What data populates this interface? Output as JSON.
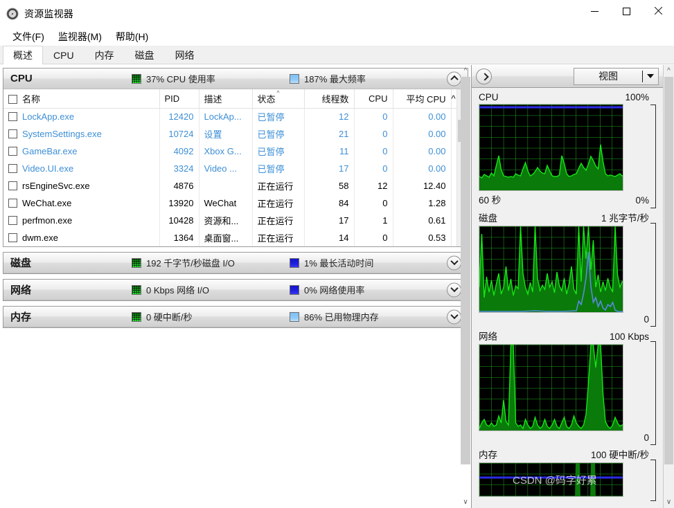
{
  "window": {
    "title": "资源监视器",
    "icon": "resource-monitor-icon",
    "minimize_label": "最小化",
    "maximize_label": "最大化",
    "close_label": "关闭"
  },
  "menu": {
    "items": [
      {
        "label": "文件(F)",
        "text": "文件",
        "accel": "F"
      },
      {
        "label": "监视器(M)",
        "text": "监视器",
        "accel": "M"
      },
      {
        "label": "帮助(H)",
        "text": "帮助",
        "accel": "H"
      }
    ]
  },
  "tabs": {
    "active": "概述",
    "items": [
      {
        "label": "概述",
        "active": true
      },
      {
        "label": "CPU",
        "active": false
      },
      {
        "label": "内存",
        "active": false
      },
      {
        "label": "磁盘",
        "active": false
      },
      {
        "label": "网络",
        "active": false
      }
    ]
  },
  "sections": {
    "cpu": {
      "title": "CPU",
      "expanded": true,
      "stat1": "37% CPU 使用率",
      "stat2": "187% 最大频率",
      "stat1_swatch": "green",
      "stat2_swatch": "light-blue",
      "collapse_label": "折叠"
    },
    "disk": {
      "title": "磁盘",
      "expanded": false,
      "stat1": "192 千字节/秒磁盘 I/O",
      "stat2": "1% 最长活动时间",
      "stat1_swatch": "green",
      "stat2_swatch": "dark-blue",
      "expand_label": "展开"
    },
    "network": {
      "title": "网络",
      "expanded": false,
      "stat1": "0 Kbps 网络 I/O",
      "stat2": "0% 网络使用率",
      "stat1_swatch": "green",
      "stat2_swatch": "dark-blue",
      "expand_label": "展开"
    },
    "memory": {
      "title": "内存",
      "expanded": false,
      "stat1": "0 硬中断/秒",
      "stat2": "86% 已用物理内存",
      "stat1_swatch": "green",
      "stat2_swatch": "light-blue",
      "expand_label": "展开"
    }
  },
  "process_table": {
    "sort_column": "状态",
    "sort_direction": "asc",
    "columns": [
      {
        "key": "name",
        "label": "名称",
        "align": "left"
      },
      {
        "key": "pid",
        "label": "PID",
        "align": "right"
      },
      {
        "key": "desc",
        "label": "描述",
        "align": "left"
      },
      {
        "key": "status",
        "label": "状态",
        "align": "left"
      },
      {
        "key": "threads",
        "label": "线程数",
        "align": "right"
      },
      {
        "key": "cpu",
        "label": "CPU",
        "align": "right"
      },
      {
        "key": "avgcpu",
        "label": "平均 CPU",
        "align": "right"
      }
    ],
    "rows": [
      {
        "name": "LockApp.exe",
        "pid": "12420",
        "desc": "LockAp...",
        "status": "已暂停",
        "threads": "12",
        "cpu": "0",
        "avgcpu": "0.00",
        "state": "suspended"
      },
      {
        "name": "SystemSettings.exe",
        "pid": "10724",
        "desc": "设置",
        "status": "已暂停",
        "threads": "21",
        "cpu": "0",
        "avgcpu": "0.00",
        "state": "suspended"
      },
      {
        "name": "GameBar.exe",
        "pid": "4092",
        "desc": "Xbox G...",
        "status": "已暂停",
        "threads": "11",
        "cpu": "0",
        "avgcpu": "0.00",
        "state": "suspended"
      },
      {
        "name": "Video.UI.exe",
        "pid": "3324",
        "desc": "Video ...",
        "status": "已暂停",
        "threads": "17",
        "cpu": "0",
        "avgcpu": "0.00",
        "state": "suspended"
      },
      {
        "name": "rsEngineSvc.exe",
        "pid": "4876",
        "desc": "",
        "status": "正在运行",
        "threads": "58",
        "cpu": "12",
        "avgcpu": "12.40",
        "state": "running"
      },
      {
        "name": "WeChat.exe",
        "pid": "13920",
        "desc": "WeChat",
        "status": "正在运行",
        "threads": "84",
        "cpu": "0",
        "avgcpu": "1.28",
        "state": "running"
      },
      {
        "name": "perfmon.exe",
        "pid": "10428",
        "desc": "资源和...",
        "status": "正在运行",
        "threads": "17",
        "cpu": "1",
        "avgcpu": "0.61",
        "state": "running"
      },
      {
        "name": "dwm.exe",
        "pid": "1364",
        "desc": "桌面窗...",
        "status": "正在运行",
        "threads": "14",
        "cpu": "0",
        "avgcpu": "0.53",
        "state": "running"
      }
    ]
  },
  "graph_panel": {
    "collapse_button": "collapse-right-arrow",
    "view_button": {
      "label": "视图",
      "caret": "chevron-down-icon"
    },
    "watermark": "CSDN @码字好累",
    "graphs": [
      {
        "name": "cpu-graph",
        "title": "CPU",
        "max_label": "100%",
        "min_label": "0%",
        "time_label": "60 秒",
        "line_color": "#16e616",
        "fill_color": "#0a7a0a",
        "secondary_color": "#2b2be6",
        "has_secondary": true
      },
      {
        "name": "disk-graph",
        "title": "磁盘",
        "max_label": "1 兆字节/秒",
        "min_label": "0",
        "time_label": "",
        "line_color": "#16e616",
        "fill_color": "#0a7a0a",
        "secondary_color": "#5a8ae0",
        "has_secondary": true
      },
      {
        "name": "network-graph",
        "title": "网络",
        "max_label": "100 Kbps",
        "min_label": "0",
        "time_label": "",
        "line_color": "#16e616",
        "fill_color": "#0a7a0a",
        "secondary_color": "",
        "has_secondary": false
      },
      {
        "name": "memory-graph",
        "title": "内存",
        "max_label": "100 硬中断/秒",
        "min_label": "",
        "time_label": "",
        "line_color": "#16e616",
        "fill_color": "#0a7a0a",
        "secondary_color": "#2b2be6",
        "has_secondary": true
      }
    ]
  },
  "chart_data": {
    "type": "area",
    "title": "资源监视器概述图表",
    "graphs": [
      {
        "id": "cpu",
        "title": "CPU",
        "ylabel": "CPU 使用率",
        "ylim": [
          0,
          100
        ],
        "yticks": [
          "0%",
          "100%"
        ],
        "xlabel": "60 秒",
        "series": [
          {
            "name": "CPU 使用率",
            "color": "#16e616",
            "values": [
              18,
              15,
              22,
              19,
              17,
              26,
              20,
              42,
              60,
              34,
              22,
              20,
              18,
              19,
              17,
              24,
              22,
              20,
              34,
              48,
              30,
              22,
              26,
              32,
              40,
              33,
              28,
              26,
              46,
              30,
              22,
              20,
              21,
              23,
              60,
              44,
              26,
              20,
              22,
              24,
              26,
              38,
              50,
              36,
              30,
              46,
              62,
              52,
              40,
              34,
              78,
              50,
              26,
              20,
              22,
              20,
              19,
              22,
              26,
              20
            ]
          },
          {
            "name": "最大频率",
            "color": "#2b2be6",
            "values": [
              98,
              98,
              98,
              98,
              98,
              98,
              98,
              98,
              98,
              98,
              98,
              98,
              98,
              98,
              98,
              98,
              98,
              98,
              98,
              98,
              98,
              98,
              98,
              98,
              98,
              98,
              98,
              98,
              98,
              98,
              98,
              98,
              98,
              98,
              98,
              98,
              98,
              98,
              98,
              98,
              98,
              98,
              98,
              98,
              98,
              98,
              98,
              98,
              98,
              98,
              98,
              98,
              98,
              98,
              98,
              98,
              98,
              98,
              98,
              98
            ]
          }
        ]
      },
      {
        "id": "disk",
        "title": "磁盘",
        "ylabel": "磁盘 I/O",
        "ylim": [
          0,
          100
        ],
        "yticks": [
          "0",
          "1 兆字节/秒"
        ],
        "series": [
          {
            "name": "磁盘 I/O",
            "color": "#16e616",
            "values": [
              30,
              88,
              18,
              42,
              24,
              38,
              20,
              34,
              46,
              22,
              30,
              54,
              26,
              40,
              20,
              32,
              28,
              100,
              46,
              30,
              22,
              36,
              24,
              100,
              40,
              26,
              34,
              28,
              46,
              30,
              36,
              24,
              48,
              32,
              26,
              40,
              22,
              34,
              54,
              28,
              22,
              100,
              36,
              100,
              62,
              100,
              50,
              84,
              30,
              44,
              26,
              36,
              28,
              40,
              30,
              26,
              100,
              44,
              30,
              36
            ]
          },
          {
            "name": "最长活动时间",
            "color": "#5a8ae0",
            "values": [
              2,
              2,
              2,
              2,
              2,
              2,
              2,
              2,
              2,
              2,
              2,
              2,
              2,
              2,
              2,
              2,
              2,
              2,
              3,
              2,
              2,
              2,
              2,
              3,
              2,
              2,
              2,
              2,
              2,
              2,
              2,
              2,
              2,
              2,
              2,
              2,
              2,
              2,
              3,
              2,
              2,
              14,
              10,
              20,
              62,
              30,
              12,
              18,
              8,
              16,
              6,
              4,
              10,
              8,
              12,
              4,
              3,
              2,
              2,
              2
            ]
          }
        ]
      },
      {
        "id": "network",
        "title": "网络",
        "ylabel": "网络 I/O",
        "ylim": [
          0,
          100
        ],
        "yticks": [
          "0",
          "100 Kbps"
        ],
        "series": [
          {
            "name": "网络 I/O",
            "color": "#16e616",
            "values": [
              4,
              10,
              14,
              8,
              6,
              10,
              6,
              8,
              18,
              10,
              32,
              12,
              8,
              100,
              100,
              10,
              6,
              8,
              4,
              14,
              8,
              4,
              6,
              16,
              8,
              4,
              6,
              14,
              6,
              4,
              8,
              14,
              6,
              4,
              10,
              16,
              6,
              4,
              8,
              18,
              10,
              6,
              4,
              8,
              20,
              56,
              100,
              100,
              70,
              100,
              100,
              40,
              12,
              6,
              4,
              8,
              16,
              10,
              6,
              8
            ]
          }
        ]
      },
      {
        "id": "memory",
        "title": "内存",
        "ylabel": "硬中断/秒",
        "ylim": [
          0,
          100
        ],
        "yticks": [
          "",
          "100 硬中断/秒"
        ],
        "series": [
          {
            "name": "硬中断/秒",
            "color": "#16e616",
            "values": [
              0,
              0,
              0,
              0,
              0,
              0,
              0,
              0,
              0,
              0,
              0,
              0,
              0,
              0,
              0,
              0,
              0,
              0,
              0,
              0,
              0,
              0,
              0,
              0,
              0,
              0,
              0,
              0,
              0,
              0,
              0,
              0,
              0,
              0,
              0,
              0,
              0,
              0,
              0,
              0,
              100,
              100,
              0,
              0,
              100,
              100,
              0,
              0,
              0,
              0,
              0,
              0,
              0,
              0,
              0,
              0,
              0,
              0,
              0,
              0
            ]
          },
          {
            "name": "已用物理内存",
            "color": "#2b2be6",
            "values": [
              50,
              50,
              50,
              50,
              50,
              50,
              50,
              50,
              50,
              50,
              50,
              50,
              50,
              50,
              50,
              50,
              50,
              50,
              50,
              50,
              50,
              50,
              50,
              50,
              50,
              50,
              50,
              50,
              50,
              50,
              50,
              50,
              50,
              50,
              50,
              50,
              50,
              50,
              50,
              50,
              50,
              50,
              50,
              50,
              50,
              50,
              50,
              50,
              50,
              50,
              50,
              50,
              50,
              50,
              50,
              50,
              50,
              50,
              50,
              50
            ]
          }
        ]
      }
    ]
  }
}
